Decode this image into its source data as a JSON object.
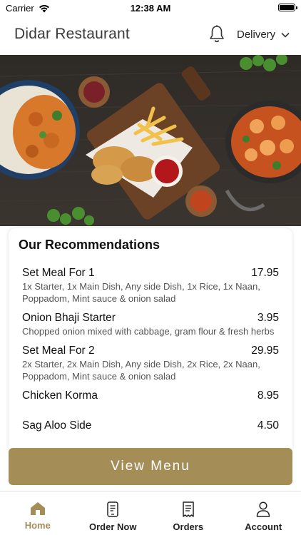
{
  "status_bar": {
    "carrier": "Carrier",
    "time": "12:38 AM"
  },
  "header": {
    "title": "Didar Restaurant",
    "delivery_label": "Delivery"
  },
  "recommendations": {
    "title": "Our Recommendations",
    "items": [
      {
        "name": "Set Meal For 1",
        "price": "17.95",
        "description": "1x Starter, 1x Main Dish, Any side Dish, 1x Rice, 1x Naan, Poppadom, Mint sauce & onion salad"
      },
      {
        "name": "Onion Bhaji Starter",
        "price": "3.95",
        "description": "Chopped onion mixed with cabbage, gram flour & fresh herbs"
      },
      {
        "name": "Set Meal For 2",
        "price": "29.95",
        "description": "2x Starter, 2x Main Dish, Any side Dish, 2x Rice, 2x Naan, Poppadom, Mint sauce & onion salad"
      },
      {
        "name": "Chicken Korma",
        "price": "8.95",
        "description": ""
      },
      {
        "name": "Sag Aloo Side",
        "price": "4.50",
        "description": ""
      }
    ]
  },
  "view_menu_label": "View Menu",
  "tabs": [
    {
      "label": "Home",
      "icon": "home-icon",
      "active": true
    },
    {
      "label": "Order Now",
      "icon": "phone-order-icon",
      "active": false
    },
    {
      "label": "Orders",
      "icon": "receipt-icon",
      "active": false
    },
    {
      "label": "Account",
      "icon": "person-icon",
      "active": false
    }
  ],
  "colors": {
    "accent": "#a58d58",
    "tab_active": "#a58d58",
    "text_dark": "#111111",
    "text_muted": "#555555"
  }
}
